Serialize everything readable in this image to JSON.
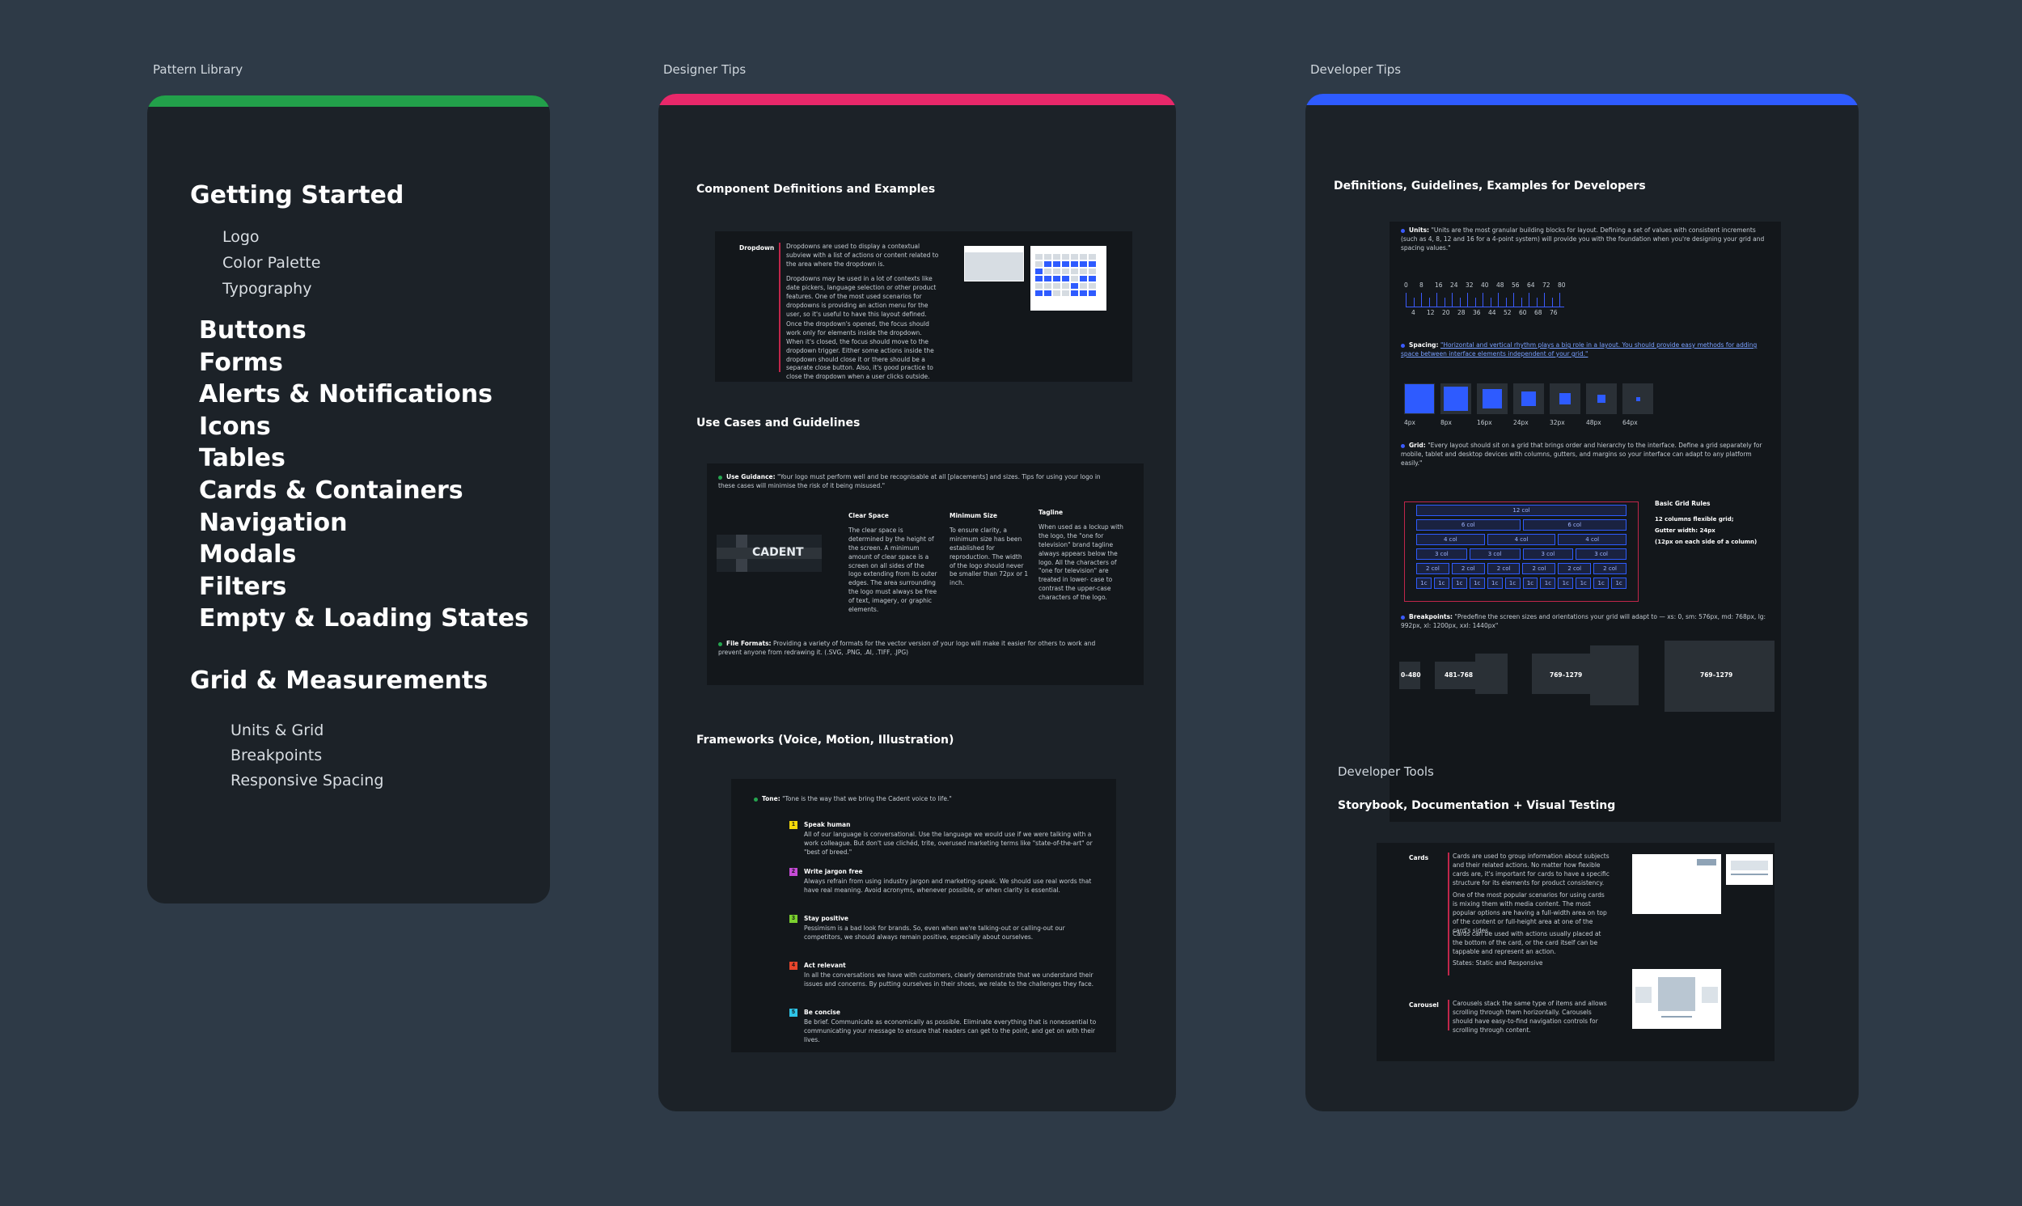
{
  "sections": {
    "pattern_library": "Pattern Library",
    "designer_tips": "Designer Tips",
    "developer_tips": "Developer Tips",
    "developer_tools": "Developer Tools"
  },
  "colors": {
    "green": "#22a04a",
    "pink": "#e8286a",
    "blue": "#2e5bff",
    "background": "#2e3a47",
    "panel": "#1c2228"
  },
  "nav": {
    "getting_started": "Getting Started",
    "getting_started_items": [
      "Logo",
      "Color Palette",
      "Typography"
    ],
    "main_items": [
      "Buttons",
      "Forms",
      "Alerts & Notifications",
      "Icons",
      "Tables",
      "Cards & Containers",
      "Navigation",
      "Modals",
      "Filters",
      "Empty & Loading States"
    ],
    "grid_heading": "Grid & Measurements",
    "grid_items": [
      "Units & Grid",
      "Breakpoints",
      "Responsive Spacing"
    ]
  },
  "designer": {
    "comp_title": "Component Definitions and Examples",
    "dropdown_label": "Dropdown",
    "dropdown_p1": "Dropdowns are used to display a contextual subview with a list of actions or content related to the area where the dropdown is.",
    "dropdown_p2": "Dropdowns may be used in a lot of contexts like date pickers, language selection or other product features. One of the most used scenarios for dropdowns is providing an action menu for the user, so it's useful to have this layout defined.",
    "dropdown_p3": "Once the dropdown's opened, the focus should work only for elements inside the dropdown. When it's closed, the focus should move to the dropdown trigger. Either some actions inside the dropdown should close it or there should be a separate close button. Also, it's good practice to close the dropdown when a user clicks outside.",
    "use_title": "Use Cases and Guidelines",
    "use_guidance_label": "Use Guidance:",
    "use_guidance": "\"Your logo must perform well and be recognisable at all [placements] and sizes. Tips for using your logo in these cases will minimise the risk of it being misused.\"",
    "logo_text": "CADENT",
    "clear_space_title": "Clear Space",
    "clear_space": "The clear space is determined by the height of the screen. A minimum amount of clear space is a screen on all sides of the logo extending from its outer edges. The area surrounding the logo must always be free of text, imagery, or graphic elements.",
    "min_size_title": "Minimum Size",
    "min_size": "To ensure clarity, a minimum size has been established for reproduction. The width of the logo should never be smaller than 72px or 1 inch.",
    "tagline_title": "Tagline",
    "tagline": "When used as a lockup with the logo, the \"one for television\" brand tagline always appears below the logo. All the characters of \"one for television\" are treated in lower- case to contrast the upper-case characters of the logo.",
    "file_formats_label": "File Formats:",
    "file_formats": "Providing a variety of formats for the vector version of your logo will make it easier for others to work and prevent anyone from redrawing it. (.SVG, .PNG, .AI, .TIFF, .JPG)",
    "frameworks_title": "Frameworks (Voice, Motion, Illustration)",
    "tone_label": "Tone:",
    "tone": "\"Tone is the way that we bring the Cadent voice to life.\"",
    "tone_items": [
      {
        "n": "1",
        "title": "Speak human",
        "text": "All of our language is conversational. Use the language we would use if we were talking with a work colleague. But don't use clichéd, trite, overused marketing terms like \"state-of-the-art\" or \"best of breed.\"",
        "color": "#f5d90a"
      },
      {
        "n": "2",
        "title": "Write jargon free",
        "text": "Always refrain from using industry jargon and marketing-speak. We should use real words that have real meaning. Avoid acronyms, whenever possible, or when clarity is essential.",
        "color": "#c64bd6"
      },
      {
        "n": "3",
        "title": "Stay positive",
        "text": "Pessimism is a bad look for brands. So, even when we're talking-out or calling-out our competitors, we should always remain positive, especially about ourselves.",
        "color": "#7bd12f"
      },
      {
        "n": "4",
        "title": "Act relevant",
        "text": "In all the conversations we have with customers, clearly demonstrate that we understand their issues and concerns. By putting ourselves in their shoes, we relate to the challenges they face.",
        "color": "#e8452c"
      },
      {
        "n": "5",
        "title": "Be concise",
        "text": "Be brief. Communicate as economically as possible. Eliminate everything that is nonessential to communicating your message to ensure that readers can get to the point, and get on with their lives.",
        "color": "#2ec5e8"
      }
    ]
  },
  "developer": {
    "title": "Definitions, Guidelines, Examples for Developers",
    "units_label": "Units:",
    "units": "\"Units are the most granular building blocks for layout. Defining a set of values with consistent increments (such as 4, 8, 12 and 16 for a 4-point system) will provide you with the foundation when you're designing your grid and spacing values.\"",
    "ruler_top": [
      "0",
      "8",
      "16",
      "24",
      "32",
      "40",
      "48",
      "56",
      "64",
      "72",
      "80"
    ],
    "ruler_bottom": [
      "4",
      "12",
      "20",
      "28",
      "36",
      "44",
      "52",
      "60",
      "68",
      "76"
    ],
    "spacing_label": "Spacing:",
    "spacing": "\"Horizontal and vertical rhythm plays a big role in a layout. You should provide easy methods for adding space between interface elements independent of your grid.\"",
    "spacing_sizes": [
      "4px",
      "8px",
      "16px",
      "24px",
      "32px",
      "48px",
      "64px"
    ],
    "grid_label": "Grid:",
    "grid": "\"Every layout should sit on a grid that brings order and hierarchy to the interface. Define a grid separately for mobile, tablet and desktop devices with columns, gutters, and margins so your interface can adapt to any platform easily.\"",
    "grid_rows": [
      [
        "12 col"
      ],
      [
        "6 col",
        "6 col"
      ],
      [
        "4 col",
        "4 col",
        "4 col"
      ],
      [
        "3 col",
        "3 col",
        "3 col",
        "3 col"
      ],
      [
        "2 col",
        "2 col",
        "2 col",
        "2 col",
        "2 col",
        "2 col"
      ],
      [
        "1c",
        "1c",
        "1c",
        "1c",
        "1c",
        "1c",
        "1c",
        "1c",
        "1c",
        "1c",
        "1c",
        "1c"
      ]
    ],
    "grid_rules_title": "Basic Grid Rules",
    "grid_rules": [
      "12 columns flexible grid;",
      "Gutter width: 24px",
      "(12px on each side of a column)"
    ],
    "breakpoints_label": "Breakpoints:",
    "breakpoints": "\"Predefine the screen sizes and orientations your grid will adapt to — xs: 0, sm: 576px, md: 768px, lg: 992px, xl: 1200px, xxl: 1440px\"",
    "breakpoint_labels": [
      "0–480",
      "481–768",
      "769–1279",
      "769–1279"
    ]
  },
  "tools": {
    "title": "Storybook, Documentation + Visual Testing",
    "cards_label": "Cards",
    "cards_p1": "Cards are used to group information about subjects and their related actions. No matter how flexible cards are, it's important for cards to have a specific structure for its elements for product consistency.",
    "cards_p2": "One of the most popular scenarios for using cards is mixing them with media content. The most popular options are having a full-width area on top of the content or full-height area at one of the card's sides.",
    "cards_p3": "Cards can be used with actions usually placed at the bottom of the card, or the card itself can be tappable and represent an action.",
    "cards_p4": "States: Static and Responsive",
    "carousel_label": "Carousel",
    "carousel_p": "Carousels stack the same type of items and allows scrolling through them horizontally. Carousels should have easy-to-find navigation controls for scrolling through content."
  }
}
